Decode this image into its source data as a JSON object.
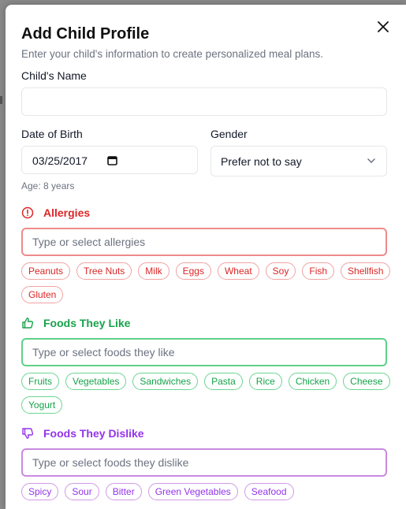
{
  "modal": {
    "title": "Add Child Profile",
    "subtitle": "Enter your child's information to create personalized meal plans.",
    "close_icon": "close-icon"
  },
  "form": {
    "name_label": "Child's Name",
    "name_value": "",
    "dob_label": "Date of Birth",
    "dob_value": "03/25/2017",
    "gender_label": "Gender",
    "gender_value": "Prefer not to say",
    "age_text": "Age: 8 years"
  },
  "allergies": {
    "heading": "Allergies",
    "icon": "alert-circle-icon",
    "placeholder": "Type or select allergies",
    "color": "#dc2626",
    "options": [
      "Peanuts",
      "Tree Nuts",
      "Milk",
      "Eggs",
      "Wheat",
      "Soy",
      "Fish",
      "Shellfish",
      "Gluten"
    ]
  },
  "likes": {
    "heading": "Foods They Like",
    "icon": "thumbs-up-icon",
    "placeholder": "Type or select foods they like",
    "color": "#16a34a",
    "options": [
      "Fruits",
      "Vegetables",
      "Sandwiches",
      "Pasta",
      "Rice",
      "Chicken",
      "Cheese",
      "Yogurt"
    ]
  },
  "dislikes": {
    "heading": "Foods They Dislike",
    "icon": "thumbs-down-icon",
    "placeholder": "Type or select foods they dislike",
    "color": "#9333ea",
    "options": [
      "Spicy",
      "Sour",
      "Bitter",
      "Green Vegetables",
      "Seafood"
    ]
  }
}
